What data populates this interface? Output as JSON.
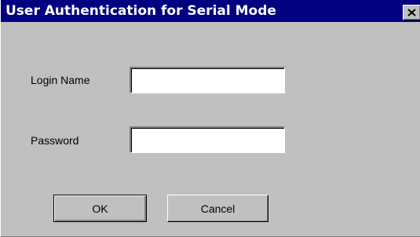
{
  "window": {
    "title": "User Authentication for Serial Mode",
    "close_icon": "close-icon"
  },
  "form": {
    "login_label": "Login Name",
    "login_value": "",
    "password_label": "Password",
    "password_value": ""
  },
  "buttons": {
    "ok_label": "OK",
    "cancel_label": "Cancel"
  },
  "colors": {
    "titlebar": "#000080",
    "face": "#c0c0c0"
  }
}
